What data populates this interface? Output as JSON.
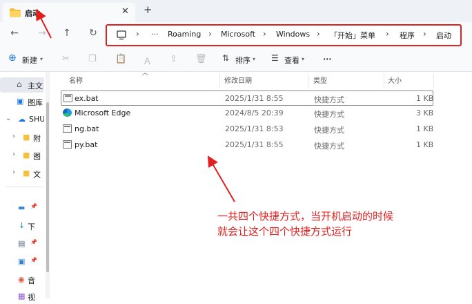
{
  "window": {
    "tab_title": "启动",
    "tab_close": "✕",
    "new_tab": "+"
  },
  "address_bar": {
    "overflow": "···",
    "crumbs": [
      "Roaming",
      "Microsoft",
      "Windows",
      "「开始」菜单",
      "程序",
      "启动"
    ],
    "separator": "›"
  },
  "command_bar": {
    "new_label": "新建",
    "sort_label": "排序",
    "view_label": "查看",
    "more_label": "···"
  },
  "sidebar": {
    "items": [
      {
        "label": "主文",
        "icon": "home-icon"
      },
      {
        "label": "图库",
        "icon": "gallery-icon"
      },
      {
        "label": "SHU",
        "icon": "cloud-icon"
      },
      {
        "label": "附",
        "icon": "folder-icon"
      },
      {
        "label": "图",
        "icon": "folder-icon"
      },
      {
        "label": "文",
        "icon": "folder-icon"
      },
      {
        "label": "",
        "icon": "desktop-icon"
      },
      {
        "label": "下",
        "icon": "download-icon"
      },
      {
        "label": "",
        "icon": "document-icon"
      },
      {
        "label": "",
        "icon": "picture-icon"
      },
      {
        "label": "音",
        "icon": "music-icon"
      },
      {
        "label": "视",
        "icon": "video-icon"
      }
    ]
  },
  "columns": {
    "name": "名称",
    "date": "修改日期",
    "type": "类型",
    "size": "大小"
  },
  "files": [
    {
      "name": "ex.bat",
      "date": "2025/1/31 8:55",
      "type": "快捷方式",
      "size": "1 KB",
      "icon": "bat-icon"
    },
    {
      "name": "Microsoft Edge",
      "date": "2024/8/5 20:39",
      "type": "快捷方式",
      "size": "3 KB",
      "icon": "edge-icon"
    },
    {
      "name": "ng.bat",
      "date": "2025/1/31 8:53",
      "type": "快捷方式",
      "size": "1 KB",
      "icon": "bat-icon"
    },
    {
      "name": "py.bat",
      "date": "2025/1/31 8:55",
      "type": "快捷方式",
      "size": "1 KB",
      "icon": "bat-icon"
    }
  ],
  "annotation": {
    "line1": "一共四个快捷方式，当开机启动的时候",
    "line2": "就会让这个四个快捷方式运行",
    "color": "#e0201f"
  }
}
